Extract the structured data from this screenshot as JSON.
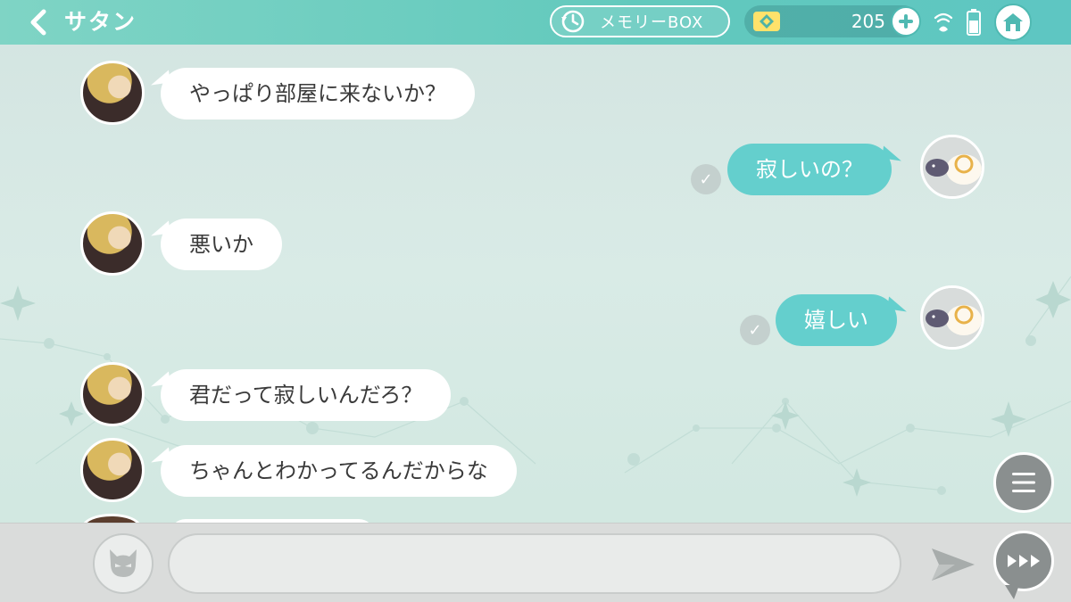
{
  "header": {
    "back_icon": "chevron-left-icon",
    "title": "サタン",
    "memory_box_label": "メモリーBOX",
    "memory_icon": "history-clock-icon",
    "currency_icon": "gem-icon",
    "currency_amount": "205",
    "plus_icon": "plus-icon",
    "signal_icon": "wifi-signal-icon",
    "battery_icon": "battery-icon",
    "home_icon": "home-icon"
  },
  "colors": {
    "header": "#62c9bd",
    "player_bubble": "#64cfcd",
    "npc_bubble": "#ffffff",
    "background": "#d9ebe6"
  },
  "messages": [
    {
      "sender": "npc",
      "text": "やっぱり部屋に来ないか？"
    },
    {
      "sender": "player",
      "text": "寂しいの？",
      "read": "✓"
    },
    {
      "sender": "npc",
      "text": "悪いか"
    },
    {
      "sender": "player",
      "text": "嬉しい",
      "read": "✓"
    },
    {
      "sender": "npc",
      "text": "君だって寂しいんだろ？"
    },
    {
      "sender": "npc",
      "text": "ちゃんとわかってるんだからな"
    }
  ],
  "controls": {
    "menu_icon": "hamburger-menu-icon",
    "stamp_icon": "demon-face-icon",
    "input_value": "",
    "input_placeholder": "",
    "send_icon": "send-arrow-icon",
    "skip_icon": "fast-forward-icon"
  }
}
